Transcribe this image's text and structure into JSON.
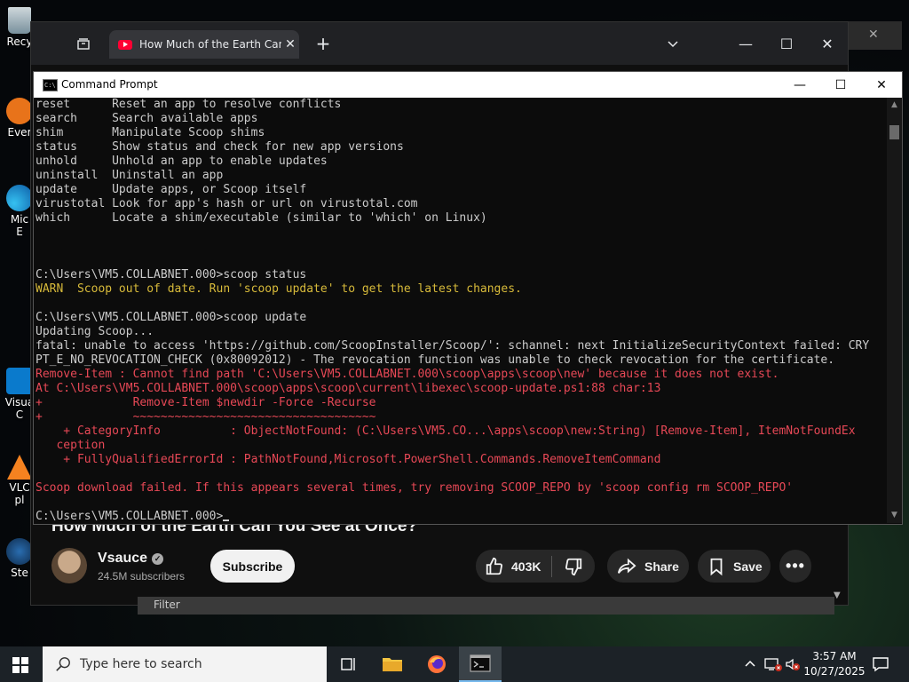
{
  "desktop": {
    "icons": [
      {
        "label": "Recy"
      },
      {
        "label": "Ever"
      },
      {
        "label": "Mic\nE"
      },
      {
        "label": "Visua\nC"
      },
      {
        "label": "VLC\npl"
      },
      {
        "label": "Ste"
      }
    ]
  },
  "browser": {
    "tab_title": "How Much of the Earth Can You",
    "controls": {
      "minimize": "—",
      "maximize": "☐",
      "close": "✕",
      "new_tab": "+",
      "tab_menu": "⌄"
    }
  },
  "youtube": {
    "video_title": "How Much of the Earth Can You See at Once?",
    "channel_name": "Vsauce",
    "subscribers": "24.5M subscribers",
    "subscribe_label": "Subscribe",
    "like_count": "403K",
    "share_label": "Share",
    "save_label": "Save",
    "filter_placeholder": "Filter"
  },
  "cmd": {
    "title": "Command Prompt",
    "lines": [
      {
        "text": "reset      Reset an app to resolve conflicts",
        "style": "normal"
      },
      {
        "text": "search     Search available apps",
        "style": "normal"
      },
      {
        "text": "shim       Manipulate Scoop shims",
        "style": "normal"
      },
      {
        "text": "status     Show status and check for new app versions",
        "style": "normal"
      },
      {
        "text": "unhold     Unhold an app to enable updates",
        "style": "normal"
      },
      {
        "text": "uninstall  Uninstall an app",
        "style": "normal"
      },
      {
        "text": "update     Update apps, or Scoop itself",
        "style": "normal"
      },
      {
        "text": "virustotal Look for app's hash or url on virustotal.com",
        "style": "normal"
      },
      {
        "text": "which      Locate a shim/executable (similar to 'which' on Linux)",
        "style": "normal"
      },
      {
        "text": "",
        "style": "normal"
      },
      {
        "text": "",
        "style": "normal"
      },
      {
        "text": "",
        "style": "normal"
      },
      {
        "text": "C:\\Users\\VM5.COLLABNET.000>scoop status",
        "style": "normal"
      },
      {
        "text": "WARN  Scoop out of date. Run 'scoop update' to get the latest changes.",
        "style": "warn"
      },
      {
        "text": "",
        "style": "normal"
      },
      {
        "text": "C:\\Users\\VM5.COLLABNET.000>scoop update",
        "style": "normal"
      },
      {
        "text": "Updating Scoop...",
        "style": "normal"
      },
      {
        "text": "fatal: unable to access 'https://github.com/ScoopInstaller/Scoop/': schannel: next InitializeSecurityContext failed: CRY",
        "style": "normal"
      },
      {
        "text": "PT_E_NO_REVOCATION_CHECK (0x80092012) - The revocation function was unable to check revocation for the certificate.",
        "style": "normal"
      },
      {
        "text": "Remove-Item : Cannot find path 'C:\\Users\\VM5.COLLABNET.000\\scoop\\apps\\scoop\\new' because it does not exist.",
        "style": "error"
      },
      {
        "text": "At C:\\Users\\VM5.COLLABNET.000\\scoop\\apps\\scoop\\current\\libexec\\scoop-update.ps1:88 char:13",
        "style": "error"
      },
      {
        "text": "+             Remove-Item $newdir -Force -Recurse",
        "style": "error"
      },
      {
        "text": "+             ~~~~~~~~~~~~~~~~~~~~~~~~~~~~~~~~~~~",
        "style": "error"
      },
      {
        "text": "    + CategoryInfo          : ObjectNotFound: (C:\\Users\\VM5.CO...\\apps\\scoop\\new:String) [Remove-Item], ItemNotFoundEx",
        "style": "error"
      },
      {
        "text": "   ception",
        "style": "error"
      },
      {
        "text": "    + FullyQualifiedErrorId : PathNotFound,Microsoft.PowerShell.Commands.RemoveItemCommand",
        "style": "error"
      },
      {
        "text": "",
        "style": "normal"
      },
      {
        "text": "Scoop download failed. If this appears several times, try removing SCOOP_REPO by 'scoop config rm SCOOP_REPO'",
        "style": "error"
      },
      {
        "text": "",
        "style": "normal"
      },
      {
        "text": "C:\\Users\\VM5.COLLABNET.000>",
        "style": "prompt"
      }
    ]
  },
  "taskbar": {
    "search_placeholder": "Type here to search",
    "time": "3:57 AM",
    "date": "10/27/2025"
  },
  "colors": {
    "warn": "#d7ba3a",
    "error": "#e74856",
    "console_text": "#cccccc"
  }
}
